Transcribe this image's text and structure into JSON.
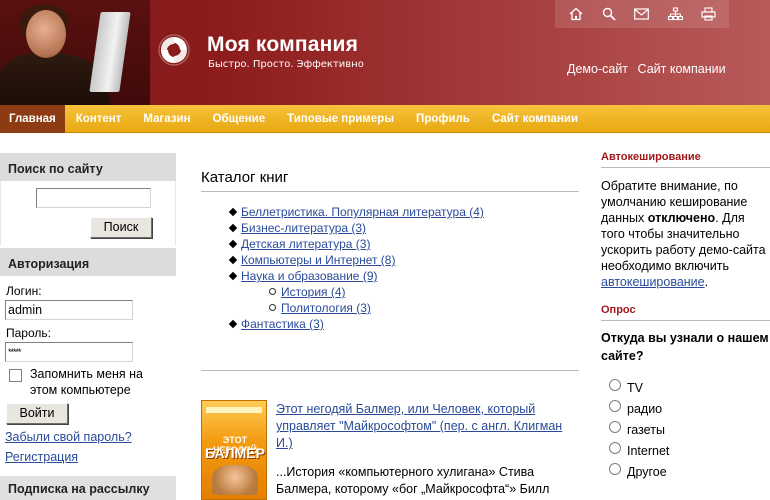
{
  "header": {
    "brand_title": "Моя компания",
    "brand_tagline": "Быстро. Просто. Эффективно",
    "top_links": [
      "Демо-сайт",
      "Сайт компании"
    ],
    "icons": [
      "home-icon",
      "search-icon",
      "mail-icon",
      "sitemap-icon",
      "print-icon"
    ]
  },
  "nav": {
    "items": [
      "Главная",
      "Контент",
      "Магазин",
      "Общение",
      "Типовые примеры",
      "Профиль",
      "Сайт компании"
    ],
    "active_index": 0
  },
  "left": {
    "search": {
      "heading": "Поиск по сайту",
      "value": "",
      "button": "Поиск"
    },
    "auth": {
      "heading": "Авторизация",
      "login_label": "Логин:",
      "login_value": "admin",
      "password_label": "Пароль:",
      "password_value": "*****",
      "remember_label": "Запомнить меня на этом компьютере",
      "remember_checked": false,
      "login_button": "Войти",
      "forgot_link": "Забыли свой пароль?",
      "register_link": "Регистрация"
    },
    "subscribe_heading": "Подписка на рассылку"
  },
  "main": {
    "heading": "Каталог книг",
    "catalog": [
      "Беллетристика. Популярная литература (4)",
      "Бизнес-литература (3)",
      "Детская литература (3)",
      "Компьютеры и Интернет (8)",
      "Наука и образование (9)",
      "История (4)",
      "Политология (3)",
      "Фантастика (3)"
    ],
    "book": {
      "cover_line1": "ЭТОТ НЕГОДЯЙ",
      "cover_line2": "БАЛМЕР",
      "title": "Этот негодяй Балмер, или Человек, который управляет \"Майкрософтом\" (пер. с англ. Клигман И.)",
      "description": "...История «компьютерного хулигана» Стива Балмера, которому «бог „Майкрософта“» Билл"
    }
  },
  "right": {
    "autocache_heading": "Автокеширование",
    "autocache_text_1": "Обратите внимание, по умолчанию кеширование данных ",
    "autocache_bold": "отключено",
    "autocache_text_2": ". Для того чтобы значительно ускорить работу демо-сайта необходимо включить ",
    "autocache_link": "автокеширование",
    "autocache_text_3": ".",
    "poll_heading": "Опрос",
    "poll_question": "Откуда вы узнали о нашем сайте?",
    "poll_options": [
      "TV",
      "радио",
      "газеты",
      "Internet",
      "Другое"
    ]
  },
  "colors": {
    "header_bg": "#8e1d1d",
    "nav_bg": "#f0b21f",
    "nav_active": "#8c3b12",
    "link": "#2a4b9a",
    "accent_red": "#a2171b"
  }
}
